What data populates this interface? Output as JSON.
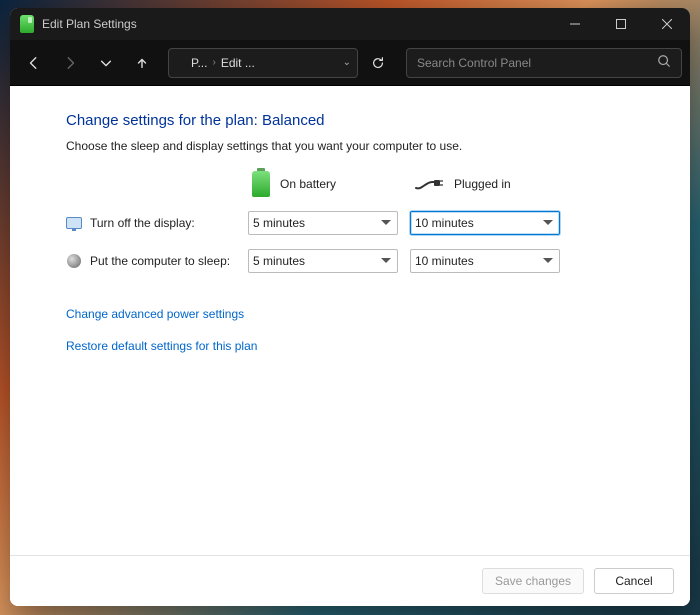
{
  "window": {
    "title": "Edit Plan Settings"
  },
  "nav": {
    "breadcrumb": {
      "seg1": "P...",
      "seg2": "Edit ..."
    },
    "search_placeholder": "Search Control Panel"
  },
  "page": {
    "heading": "Change settings for the plan: Balanced",
    "subtext": "Choose the sleep and display settings that you want your computer to use.",
    "col_battery": "On battery",
    "col_plugged": "Plugged in",
    "row_display": "Turn off the display:",
    "row_sleep": "Put the computer to sleep:",
    "display_battery": "5 minutes",
    "display_plugged": "10 minutes",
    "sleep_battery": "5 minutes",
    "sleep_plugged": "10 minutes",
    "link_advanced": "Change advanced power settings",
    "link_restore": "Restore default settings for this plan"
  },
  "footer": {
    "save": "Save changes",
    "cancel": "Cancel"
  }
}
